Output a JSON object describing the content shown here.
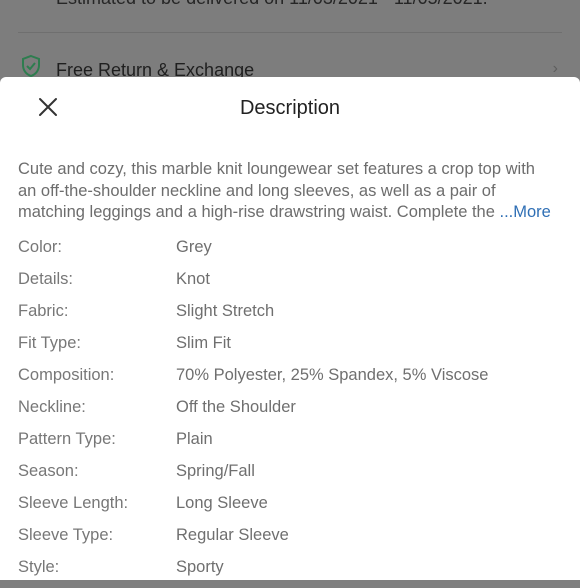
{
  "background": {
    "delivery_text": "Estimated to be delivered on 11/03/2021 - 11/05/2021.",
    "return_label": "Free Return & Exchange",
    "shield_icon": "shield-check-icon",
    "chevron_icon": "chevron-right-icon",
    "accent_color": "#2e7d4f"
  },
  "sheet": {
    "title": "Description",
    "close_icon": "close-icon",
    "description": {
      "lines": [
        "Cute and cozy, this marble knit loungewear set features a crop top with",
        "an off-the-shoulder neckline and long sleeves, as well as a pair of",
        "matching leggings and a high-rise drawstring waist. Complete the "
      ],
      "ellipsis": "...",
      "more_label": "More",
      "more_color": "#2f6fb5"
    },
    "attributes": [
      {
        "key": "Color:",
        "value": "Grey"
      },
      {
        "key": "Details:",
        "value": "Knot"
      },
      {
        "key": "Fabric:",
        "value": "Slight Stretch"
      },
      {
        "key": "Fit Type:",
        "value": "Slim Fit"
      },
      {
        "key": "Composition:",
        "value": "70% Polyester, 25% Spandex, 5% Viscose"
      },
      {
        "key": "Neckline:",
        "value": "Off the Shoulder"
      },
      {
        "key": "Pattern Type:",
        "value": "Plain"
      },
      {
        "key": "Season:",
        "value": "Spring/Fall"
      },
      {
        "key": "Sleeve Length:",
        "value": "Long Sleeve"
      },
      {
        "key": "Sleeve Type:",
        "value": "Regular Sleeve"
      },
      {
        "key": "Style:",
        "value": "Sporty"
      }
    ]
  }
}
